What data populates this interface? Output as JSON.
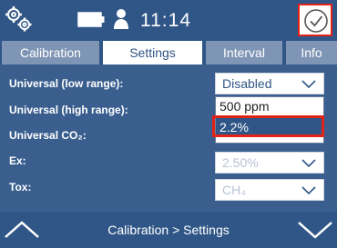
{
  "header": {
    "time": "11:14"
  },
  "tabs": [
    {
      "label": "Calibration",
      "active": false
    },
    {
      "label": "Settings",
      "active": true
    },
    {
      "label": "Interval",
      "active": false
    },
    {
      "label": "Info",
      "active": false
    }
  ],
  "settings": {
    "rows": [
      {
        "label": "Universal (low range):",
        "value": "Disabled",
        "enabled": true
      },
      {
        "label": "Universal (high range):",
        "value": "500 ppm",
        "enabled": true
      },
      {
        "label": "Universal CO₂:",
        "value": "",
        "enabled": true
      },
      {
        "label": "Ex:",
        "value": "2.50%",
        "enabled": false
      },
      {
        "label": "Tox:",
        "value": "CH₄",
        "enabled": false
      }
    ],
    "dropdown_options": [
      "500 ppm",
      "2.2%"
    ],
    "dropdown_selected": "2.2%"
  },
  "footer": {
    "breadcrumb": "Calibration > Settings"
  },
  "colors": {
    "primary": "#2f5687",
    "content_bg": "#3a5f8f",
    "tab_inactive": "#7f95b5",
    "highlight": "#e2231a"
  }
}
